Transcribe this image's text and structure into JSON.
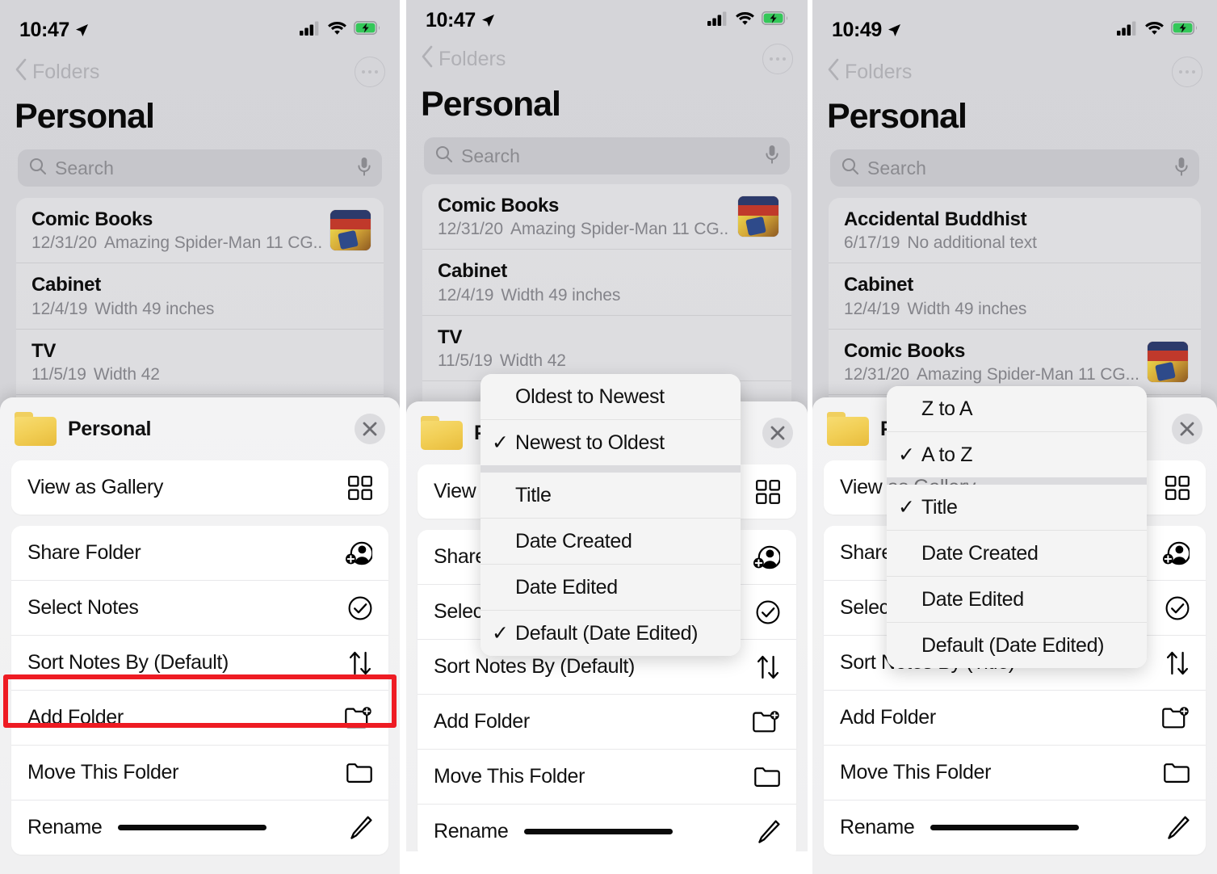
{
  "panels": [
    {
      "id": "panel-1",
      "status": {
        "time": "10:47",
        "location_icon": "location-arrow-icon",
        "signal_icon": "cellular-signal-icon",
        "wifi_icon": "wifi-icon",
        "battery_icon": "battery-charging-icon"
      },
      "nav": {
        "back_label": "Folders",
        "more_icon": "ellipsis-circle-icon"
      },
      "title": "Personal",
      "search": {
        "placeholder": "Search",
        "search_icon": "search-icon",
        "mic_icon": "microphone-icon"
      },
      "notes": [
        {
          "title": "Comic Books",
          "date": "12/31/20",
          "snippet": "Amazing Spider-Man 11 CG...",
          "has_thumb": true
        },
        {
          "title": "Cabinet",
          "date": "12/4/19",
          "snippet": "Width 49 inches",
          "has_thumb": false
        },
        {
          "title": "TV",
          "date": "11/5/19",
          "snippet": "Width 42",
          "has_thumb": false
        }
      ],
      "sheet": {
        "folder_icon": "folder-icon",
        "title": "Personal",
        "close_icon": "close-icon",
        "groups": [
          [
            {
              "label": "View as Gallery",
              "icon": "grid-icon"
            }
          ],
          [
            {
              "label": "Share Folder",
              "icon": "person-add-icon"
            },
            {
              "label": "Select Notes",
              "icon": "circle-check-icon"
            },
            {
              "label": "Sort Notes By (Default)",
              "icon": "sort-arrows-icon",
              "highlighted": true
            },
            {
              "label": "Add Folder",
              "icon": "folder-add-icon"
            },
            {
              "label": "Move This Folder",
              "icon": "folder-outline-icon"
            },
            {
              "label": "Rename",
              "icon": "pencil-icon",
              "redacted": true
            }
          ]
        ]
      },
      "popover": null
    },
    {
      "id": "panel-2",
      "status": {
        "time": "10:47",
        "location_icon": "location-arrow-icon",
        "signal_icon": "cellular-signal-icon",
        "wifi_icon": "wifi-icon",
        "battery_icon": "battery-charging-icon"
      },
      "nav": {
        "back_label": "Folders",
        "more_icon": "ellipsis-circle-icon"
      },
      "title": "Personal",
      "search": {
        "placeholder": "Search",
        "search_icon": "search-icon",
        "mic_icon": "microphone-icon"
      },
      "notes": [
        {
          "title": "Comic Books",
          "date": "12/31/20",
          "snippet": "Amazing Spider-Man 11 CG...",
          "has_thumb": true
        },
        {
          "title": "Cabinet",
          "date": "12/4/19",
          "snippet": "Width 49 inches",
          "has_thumb": false
        },
        {
          "title": "TV",
          "date": "11/5/19",
          "snippet": "Width 42",
          "has_thumb": false
        }
      ],
      "sheet": {
        "folder_icon": "folder-icon",
        "title": "Personal",
        "close_icon": "close-icon",
        "groups": [
          [
            {
              "label": "View as Gallery",
              "icon": "grid-icon"
            }
          ],
          [
            {
              "label": "Share Folder",
              "icon": "person-add-icon"
            },
            {
              "label": "Select Notes",
              "icon": "circle-check-icon"
            },
            {
              "label": "Sort Notes By (Default)",
              "icon": "sort-arrows-icon"
            },
            {
              "label": "Add Folder",
              "icon": "folder-add-icon"
            },
            {
              "label": "Move This Folder",
              "icon": "folder-outline-icon"
            },
            {
              "label": "Rename",
              "icon": "pencil-icon",
              "redacted": true
            }
          ]
        ]
      },
      "popover": {
        "groups": [
          [
            {
              "label": "Oldest to Newest",
              "checked": false
            },
            {
              "label": "Newest to Oldest",
              "checked": true
            }
          ],
          [
            {
              "label": "Title",
              "checked": false
            },
            {
              "label": "Date Created",
              "checked": false
            },
            {
              "label": "Date Edited",
              "checked": false
            },
            {
              "label": "Default (Date Edited)",
              "checked": true
            }
          ]
        ]
      }
    },
    {
      "id": "panel-3",
      "status": {
        "time": "10:49",
        "location_icon": "location-arrow-icon",
        "signal_icon": "cellular-signal-icon",
        "wifi_icon": "wifi-icon",
        "battery_icon": "battery-charging-icon"
      },
      "nav": {
        "back_label": "Folders",
        "more_icon": "ellipsis-circle-icon"
      },
      "title": "Personal",
      "search": {
        "placeholder": "Search",
        "search_icon": "search-icon",
        "mic_icon": "microphone-icon"
      },
      "notes": [
        {
          "title": "Accidental Buddhist",
          "date": "6/17/19",
          "snippet": "No additional text",
          "has_thumb": false
        },
        {
          "title": "Cabinet",
          "date": "12/4/19",
          "snippet": "Width 49 inches",
          "has_thumb": false
        },
        {
          "title": "Comic Books",
          "date": "12/31/20",
          "snippet": "Amazing Spider-Man 11 CG...",
          "has_thumb": true
        }
      ],
      "sheet": {
        "folder_icon": "folder-icon",
        "title": "Personal",
        "close_icon": "close-icon",
        "groups": [
          [
            {
              "label": "View as Gallery",
              "icon": "grid-icon"
            }
          ],
          [
            {
              "label": "Share Folder",
              "icon": "person-add-icon"
            },
            {
              "label": "Select Notes",
              "icon": "circle-check-icon"
            },
            {
              "label": "Sort Notes By (Title)",
              "icon": "sort-arrows-icon"
            },
            {
              "label": "Add Folder",
              "icon": "folder-add-icon"
            },
            {
              "label": "Move This Folder",
              "icon": "folder-outline-icon"
            },
            {
              "label": "Rename",
              "icon": "pencil-icon",
              "redacted": true
            }
          ]
        ]
      },
      "popover": {
        "groups": [
          [
            {
              "label": "Z to A",
              "checked": false
            },
            {
              "label": "A to Z",
              "checked": true
            }
          ],
          [
            {
              "label": "Title",
              "checked": true
            },
            {
              "label": "Date Created",
              "checked": false
            },
            {
              "label": "Date Edited",
              "checked": false
            },
            {
              "label": "Default (Date Edited)",
              "checked": false
            }
          ]
        ]
      }
    }
  ],
  "colors": {
    "highlight": "#ee1b23",
    "folder_yellow": "#f2cf56",
    "battery_green": "#34c759",
    "sheet_bg": "#f3f3f4",
    "page_bg": "#d4d4d8"
  }
}
